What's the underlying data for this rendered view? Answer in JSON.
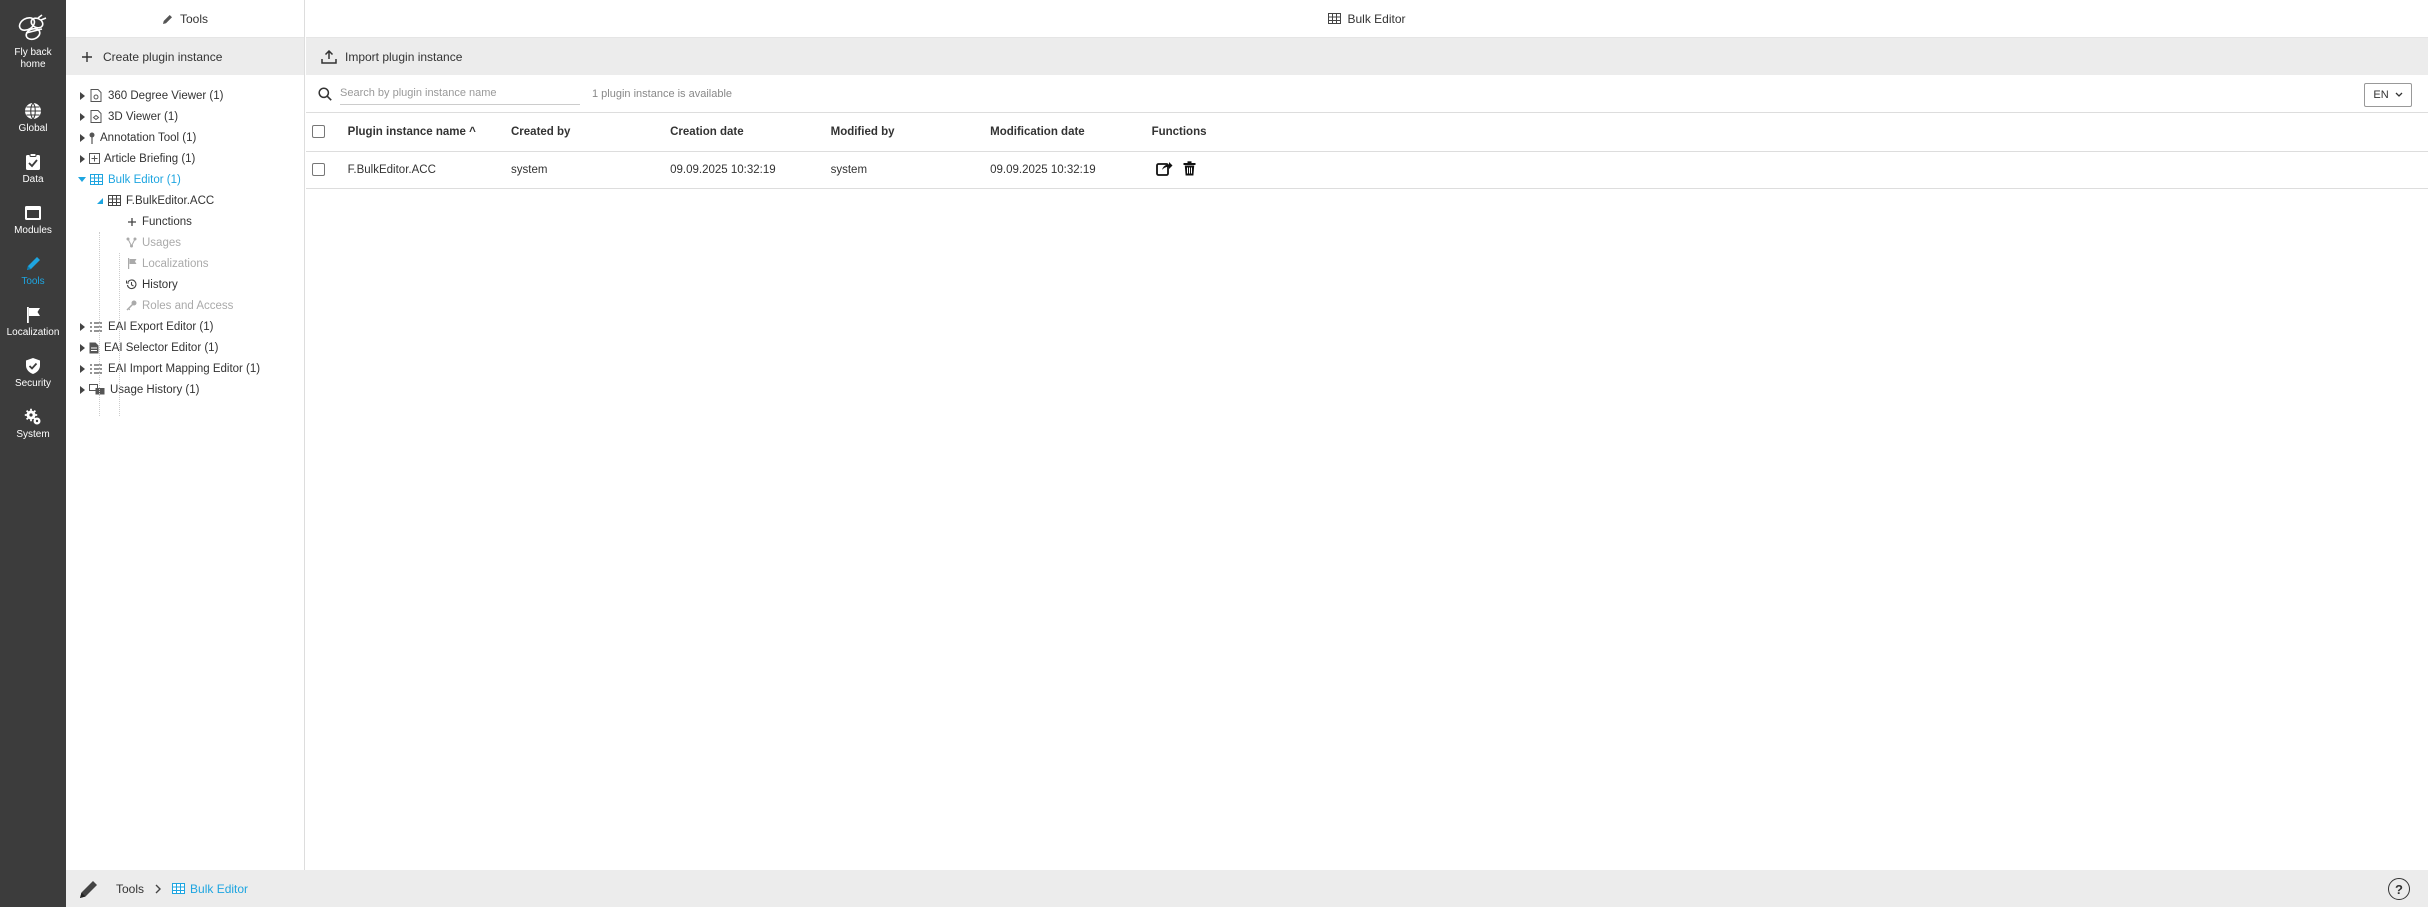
{
  "rail": {
    "home_line1": "Fly back",
    "home_line2": "home",
    "items": [
      {
        "label": "Global",
        "icon": "globe-icon"
      },
      {
        "label": "Data",
        "icon": "clipboard-icon"
      },
      {
        "label": "Modules",
        "icon": "window-icon"
      },
      {
        "label": "Tools",
        "icon": "pencil-icon"
      },
      {
        "label": "Localization",
        "icon": "flag-icon"
      },
      {
        "label": "Security",
        "icon": "shield-icon"
      },
      {
        "label": "System",
        "icon": "gears-icon"
      }
    ],
    "active": "Tools"
  },
  "tree_panel": {
    "title": "Tools",
    "create_label": "Create plugin instance",
    "items": [
      {
        "label": "360 Degree Viewer (1)"
      },
      {
        "label": "3D Viewer (1)"
      },
      {
        "label": "Annotation Tool (1)"
      },
      {
        "label": "Article Briefing (1)"
      },
      {
        "label": "Bulk Editor (1)"
      },
      {
        "label": "F.BulkEditor.ACC"
      },
      {
        "label": "Functions"
      },
      {
        "label": "Usages"
      },
      {
        "label": "Localizations"
      },
      {
        "label": "History"
      },
      {
        "label": "Roles and Access"
      },
      {
        "label": "EAI Export Editor (1)"
      },
      {
        "label": "EAI Selector Editor (1)"
      },
      {
        "label": "EAI Import Mapping Editor (1)"
      },
      {
        "label": "Usage History (1)"
      }
    ]
  },
  "main": {
    "title": "Bulk Editor",
    "import_label": "Import plugin instance",
    "search_placeholder": "Search by plugin instance name",
    "count_text": "1 plugin instance is available",
    "language": "EN",
    "columns": [
      "Plugin instance name ^",
      "Created by",
      "Creation date",
      "Modified by",
      "Modification date",
      "Functions"
    ],
    "rows": [
      {
        "name": "F.BulkEditor.ACC",
        "created_by": "system",
        "creation_date": "09.09.2025 10:32:19",
        "modified_by": "system",
        "modification_date": "09.09.2025 10:32:19"
      }
    ]
  },
  "footer": {
    "crumb_tools": "Tools",
    "crumb_current": "Bulk Editor",
    "help": "?"
  },
  "colors": {
    "accent": "#1ea5e0",
    "rail_bg": "#3c3c3c",
    "toolbar_bg": "#ececec"
  }
}
